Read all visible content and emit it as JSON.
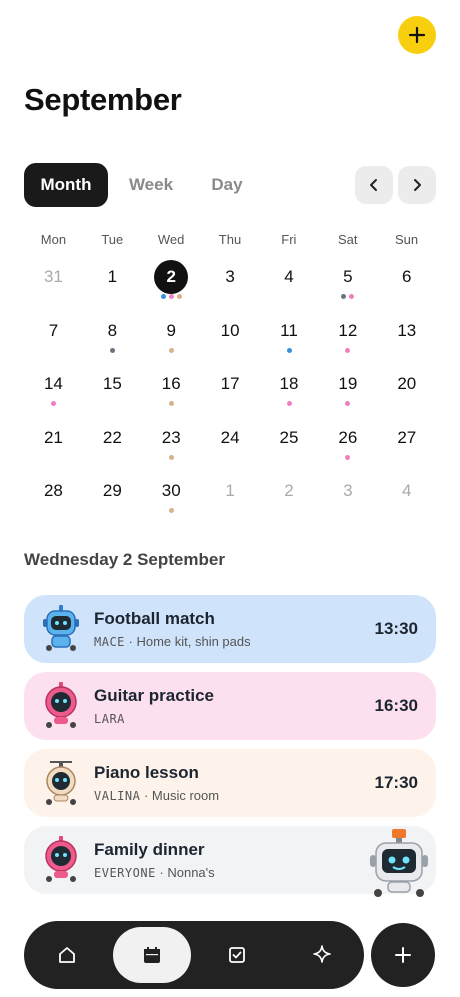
{
  "header": {
    "title": "September"
  },
  "view_switch": {
    "options": [
      "Month",
      "Week",
      "Day"
    ],
    "selected": "Month"
  },
  "calendar": {
    "weekdays": [
      "Mon",
      "Tue",
      "Wed",
      "Thu",
      "Fri",
      "Sat",
      "Sun"
    ],
    "selected_day": "2",
    "weeks": [
      [
        {
          "n": "31",
          "muted": true,
          "dots": []
        },
        {
          "n": "1",
          "dots": []
        },
        {
          "n": "2",
          "selected": true,
          "dots": [
            "#3b8fd9",
            "#ee7fc0",
            "#d8b08a"
          ]
        },
        {
          "n": "3",
          "dots": []
        },
        {
          "n": "4",
          "dots": []
        },
        {
          "n": "5",
          "dots": [
            "#6b7280",
            "#ee7fc0"
          ]
        },
        {
          "n": "6",
          "dots": []
        }
      ],
      [
        {
          "n": "7",
          "dots": []
        },
        {
          "n": "8",
          "dots": [
            "#6b7280"
          ]
        },
        {
          "n": "9",
          "dots": [
            "#d8b08a"
          ]
        },
        {
          "n": "10",
          "dots": []
        },
        {
          "n": "11",
          "dots": [
            "#3b8fd9"
          ]
        },
        {
          "n": "12",
          "dots": [
            "#ee7fc0"
          ]
        },
        {
          "n": "13",
          "dots": []
        }
      ],
      [
        {
          "n": "14",
          "dots": [
            "#ee7fc0"
          ]
        },
        {
          "n": "15",
          "dots": []
        },
        {
          "n": "16",
          "dots": [
            "#d8b08a"
          ]
        },
        {
          "n": "17",
          "dots": []
        },
        {
          "n": "18",
          "dots": [
            "#ee7fc0"
          ]
        },
        {
          "n": "19",
          "dots": [
            "#ee7fc0"
          ]
        },
        {
          "n": "20",
          "dots": []
        }
      ],
      [
        {
          "n": "21",
          "dots": []
        },
        {
          "n": "22",
          "dots": []
        },
        {
          "n": "23",
          "dots": [
            "#d8b08a"
          ]
        },
        {
          "n": "24",
          "dots": []
        },
        {
          "n": "25",
          "dots": []
        },
        {
          "n": "26",
          "dots": [
            "#ee7fc0"
          ]
        },
        {
          "n": "27",
          "dots": []
        }
      ],
      [
        {
          "n": "28",
          "dots": []
        },
        {
          "n": "29",
          "dots": []
        },
        {
          "n": "30",
          "dots": [
            "#d8b08a"
          ]
        },
        {
          "n": "1",
          "muted": true,
          "dots": []
        },
        {
          "n": "2",
          "muted": true,
          "dots": []
        },
        {
          "n": "3",
          "muted": true,
          "dots": []
        },
        {
          "n": "4",
          "muted": true,
          "dots": []
        }
      ]
    ]
  },
  "agenda": {
    "date_label": "Wednesday 2 September",
    "events": [
      {
        "title": "Football match",
        "who": "MACE",
        "note": " · Home kit, shin pads",
        "time": "13:30",
        "bg": "#cfe4fb",
        "avatar": "blue-robot-icon"
      },
      {
        "title": "Guitar practice",
        "who": "LARA",
        "note": "",
        "time": "16:30",
        "bg": "#fde0ef",
        "avatar": "pink-robot-icon"
      },
      {
        "title": "Piano lesson",
        "who": "VALINA",
        "note": " · Music room",
        "time": "17:30",
        "bg": "#fdf3ea",
        "avatar": "tan-robot-icon"
      },
      {
        "title": "Family dinner",
        "who": "EVERYONE",
        "note": " · Nonna's",
        "time": "",
        "bg": "#f1f3f5",
        "avatar": "pink-robot-icon"
      }
    ]
  },
  "bottom_nav": {
    "items": [
      "home-icon",
      "calendar-icon",
      "checklist-icon",
      "sparkle-icon"
    ],
    "active": "calendar-icon"
  },
  "colors": {
    "accent_yellow": "#f8cf0f",
    "dark": "#1a1a1a"
  }
}
